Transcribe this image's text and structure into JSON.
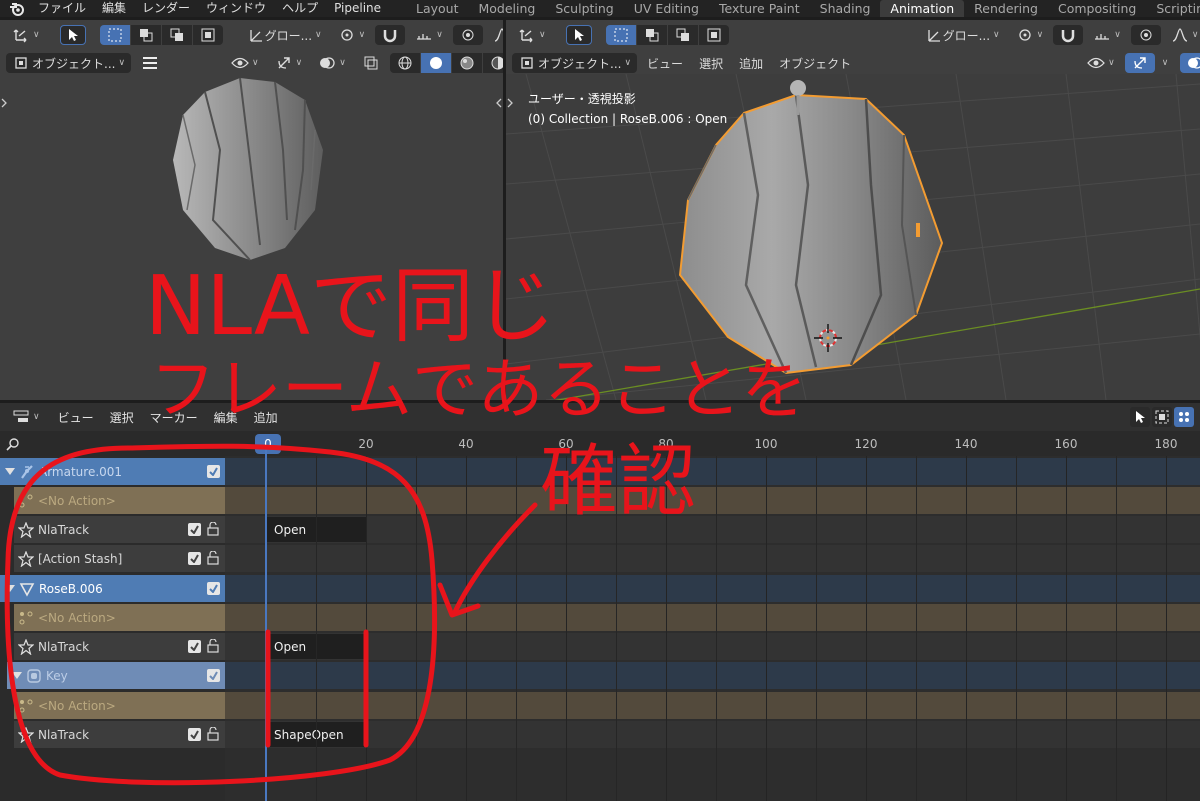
{
  "topbar": {
    "menus": [
      "ファイル",
      "編集",
      "レンダー",
      "ウィンドウ",
      "ヘルプ",
      "Pipeline"
    ],
    "workspaces": [
      "Layout",
      "Modeling",
      "Sculpting",
      "UV Editing",
      "Texture Paint",
      "Shading",
      "Animation",
      "Rendering",
      "Compositing",
      "Scripting"
    ],
    "active_workspace": "Animation"
  },
  "viewport_left": {
    "transform_label": "グロー...",
    "mode_label": "オブジェクト..."
  },
  "viewport_right": {
    "transform_label": "グロー...",
    "mode_label": "オブジェクト...",
    "menus": [
      "ビュー",
      "選択",
      "追加",
      "オブジェクト"
    ],
    "view_name": "ユーザー・透視投影",
    "collection_info": "(0) Collection | RoseB.006 : Open"
  },
  "nla": {
    "menus": [
      "ビュー",
      "選択",
      "マーカー",
      "編集",
      "追加"
    ],
    "current_frame": "0",
    "ruler_ticks": [
      "20",
      "40",
      "60",
      "80",
      "100",
      "120",
      "140",
      "160",
      "180"
    ],
    "channels": [
      {
        "label": "Armature.001",
        "kind": "object"
      },
      {
        "label": "<No Action>",
        "kind": "action"
      },
      {
        "label": "NlaTrack",
        "kind": "track"
      },
      {
        "label": "[Action Stash]",
        "kind": "track"
      },
      {
        "label": "RoseB.006",
        "kind": "object"
      },
      {
        "label": "<No Action>",
        "kind": "action"
      },
      {
        "label": "NlaTrack",
        "kind": "track"
      },
      {
        "label": "Key",
        "kind": "shapekey"
      },
      {
        "label": "<No Action>",
        "kind": "action"
      },
      {
        "label": "NlaTrack",
        "kind": "track"
      }
    ],
    "strips": [
      {
        "label": "Open",
        "row": 2
      },
      {
        "label": "Open",
        "row": 6
      },
      {
        "label": "ShapeOpen",
        "row": 9
      }
    ]
  },
  "annotation": {
    "line1": "NLAで同じ",
    "line2": "フレームであることを",
    "line3": "確認",
    "color": "#e8141b"
  },
  "colors": {
    "accent": "#4772b3",
    "object_channel": "#4f7cb4",
    "action_channel": "#7f7055",
    "selection_outline": "#f39c32"
  }
}
